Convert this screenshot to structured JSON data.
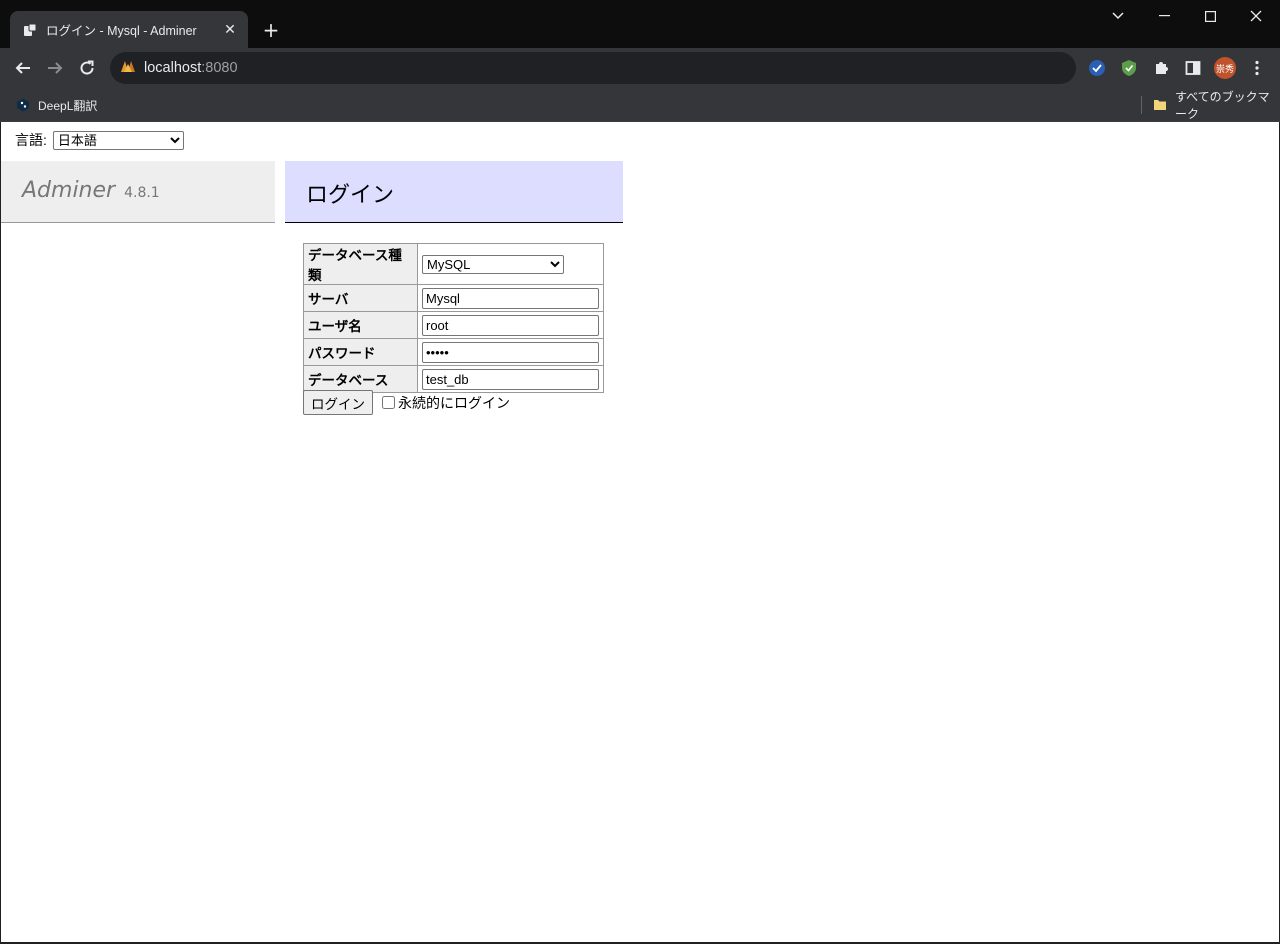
{
  "browser": {
    "tab_title": "ログイン - Mysql - Adminer",
    "url_host": "localhost",
    "url_port": ":8080",
    "profile_initials": "崇秀",
    "bookmarks": {
      "deepl": "DeepL翻訳",
      "all_bookmarks": "すべてのブックマーク"
    }
  },
  "page": {
    "language_label": "言語:",
    "language_selected": "日本語",
    "app_name": "Adminer",
    "app_version": "4.8.1",
    "heading": "ログイン",
    "form": {
      "fields": [
        {
          "label": "データベース種類",
          "value": "MySQL"
        },
        {
          "label": "サーバ",
          "value": "Mysql"
        },
        {
          "label": "ユーザ名",
          "value": "root"
        },
        {
          "label": "パスワード",
          "value": "•••••"
        },
        {
          "label": "データベース",
          "value": "test_db"
        }
      ],
      "submit_label": "ログイン",
      "permanent_label": "永続的にログイン"
    }
  },
  "colors": {
    "menu_bg": "#eeeeee",
    "heading_bg": "#ddddff",
    "chrome_dark": "#35363a",
    "avatar": "#c0532c"
  }
}
